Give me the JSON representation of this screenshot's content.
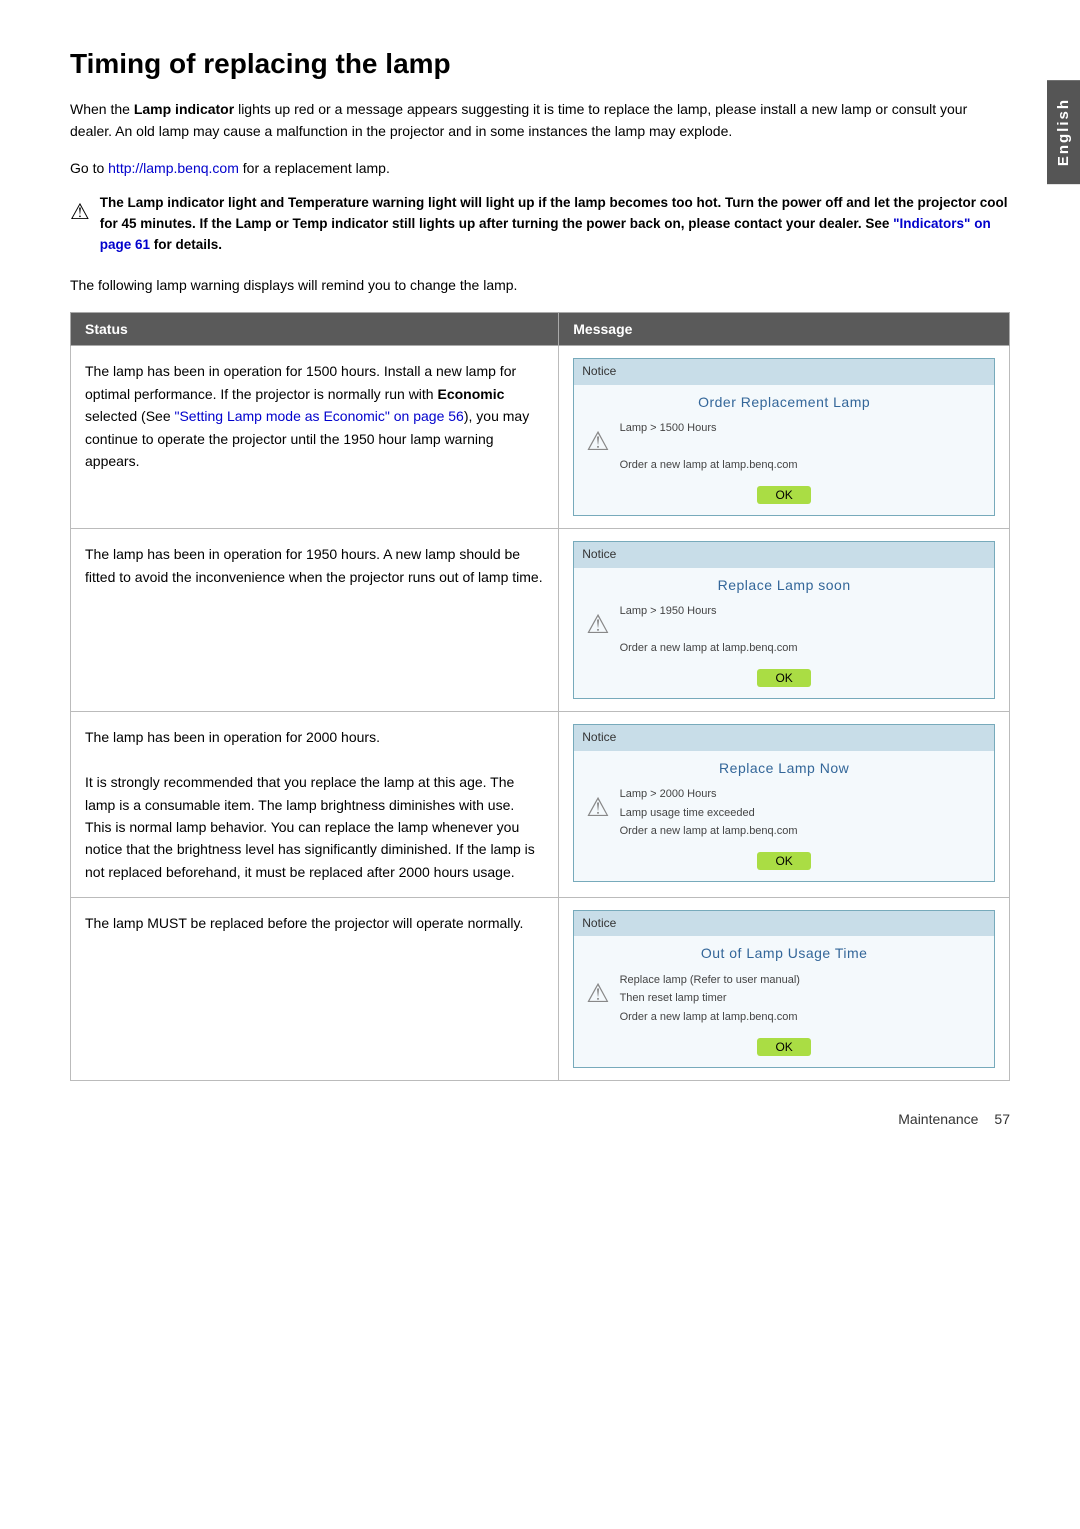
{
  "page": {
    "title": "Timing of replacing the lamp",
    "side_tab": "English",
    "intro_paragraph": "When the ",
    "intro_bold": "Lamp indicator",
    "intro_rest": " lights up red or a message appears suggesting it is time to replace the lamp, please install a new lamp or consult your dealer. An old lamp may cause a malfunction in the projector and in some instances the lamp may explode.",
    "lamp_link_text": "http://lamp.benq.com",
    "lamp_link_prefix": "Go to ",
    "lamp_link_suffix": " for a replacement lamp.",
    "warning": {
      "icon": "⚠",
      "text_parts": [
        {
          "bold": true,
          "text": "The Lamp indicator light and Temperature warning light will light up if the lamp becomes too hot. Turn the power off and let the projector cool for 45 minutes. If the Lamp or Temp indicator still lights up after turning the power back on, please contact your dealer. See "
        },
        {
          "bold": false,
          "link": true,
          "text": "\"Indicators\" on page 61"
        },
        {
          "bold": true,
          "text": " for details."
        }
      ]
    },
    "following_text": "The following lamp warning displays will remind you to change the lamp.",
    "table": {
      "headers": [
        "Status",
        "Message"
      ],
      "rows": [
        {
          "status": "The lamp has been in operation for 1500 hours. Install a new lamp for optimal performance. If the projector is normally run with Economic selected (See \"Setting Lamp mode as Economic\" on page 56), you may continue to operate the projector until the 1950 hour lamp warning appears.",
          "status_link": "\"Setting Lamp mode as Economic\" on page 56",
          "dialog": {
            "notice_label": "Notice",
            "title": "Order Replacement Lamp",
            "lines": [
              "Lamp > 1500 Hours",
              "",
              "Order a new lamp at lamp.benq.com"
            ],
            "ok": "OK"
          }
        },
        {
          "status": "The lamp has been in operation for 1950 hours. A new lamp should be fitted to avoid the inconvenience when the projector runs out of lamp time.",
          "dialog": {
            "notice_label": "Notice",
            "title": "Replace Lamp soon",
            "lines": [
              "Lamp > 1950 Hours",
              "",
              "Order a new lamp at lamp.benq.com"
            ],
            "ok": "OK"
          }
        },
        {
          "status_parts": [
            "The lamp has been in operation for 2000 hours.",
            "It is strongly recommended that you replace the lamp at this age. The lamp is a consumable item. The lamp brightness diminishes with use. This is normal lamp behavior. You can replace the lamp whenever you notice that the brightness level has significantly diminished. If the lamp is not replaced beforehand, it must be replaced after 2000 hours usage."
          ],
          "dialog": {
            "notice_label": "Notice",
            "title": "Replace Lamp Now",
            "lines": [
              "Lamp > 2000 Hours",
              "Lamp usage time exceeded",
              "Order a new lamp at lamp.benq.com"
            ],
            "ok": "OK"
          }
        },
        {
          "status": "The lamp MUST be replaced before the projector will operate normally.",
          "dialog": {
            "notice_label": "Notice",
            "title": "Out of Lamp Usage Time",
            "lines": [
              "Replace lamp (Refer to user manual)",
              "Then reset lamp timer",
              "Order a new lamp at lamp.benq.com"
            ],
            "ok": "OK"
          }
        }
      ]
    },
    "footer": {
      "section_label": "Maintenance",
      "page_number": "57"
    }
  }
}
